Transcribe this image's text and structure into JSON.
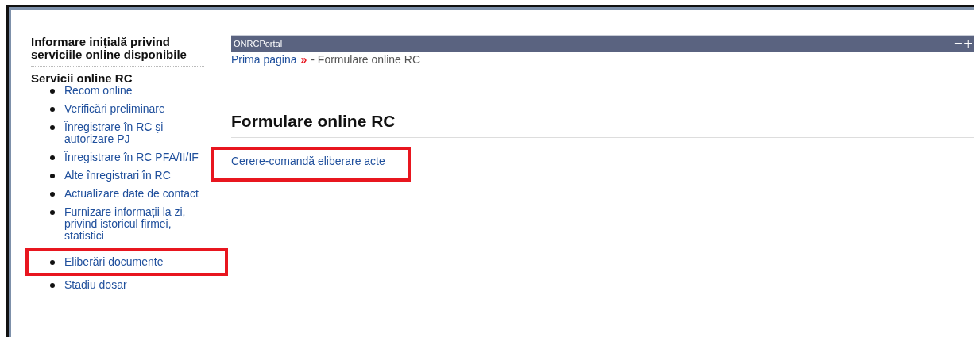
{
  "sidebar": {
    "intro_heading": "Informare inițială privind serviciile online disponibile",
    "section_heading": "Servicii online RC",
    "items": [
      {
        "label": "Recom online",
        "highlighted": false
      },
      {
        "label": "Verificări preliminare",
        "highlighted": false
      },
      {
        "label": "Înregistrare în RC și autorizare PJ",
        "highlighted": false
      },
      {
        "label": "Înregistrare în RC PFA/II/IF",
        "highlighted": false
      },
      {
        "label": "Alte înregistrari în RC",
        "highlighted": false
      },
      {
        "label": "Actualizare date de contact",
        "highlighted": false
      },
      {
        "label": "Furnizare informații la zi, privind istoricul firmei, statistici",
        "highlighted": false
      },
      {
        "label": "Eliberări documente",
        "highlighted": true
      },
      {
        "label": "Stadiu dosar",
        "highlighted": false
      }
    ]
  },
  "portlet": {
    "title": "ONRCPortal",
    "controls": [
      "−",
      "+"
    ]
  },
  "breadcrumb": {
    "home": "Prima pagina",
    "separator": "»",
    "current": "- Formulare online RC"
  },
  "page_title": "Formulare online RC",
  "forms": [
    {
      "label": "Cerere-comandă eliberare acte",
      "highlighted": true
    }
  ]
}
